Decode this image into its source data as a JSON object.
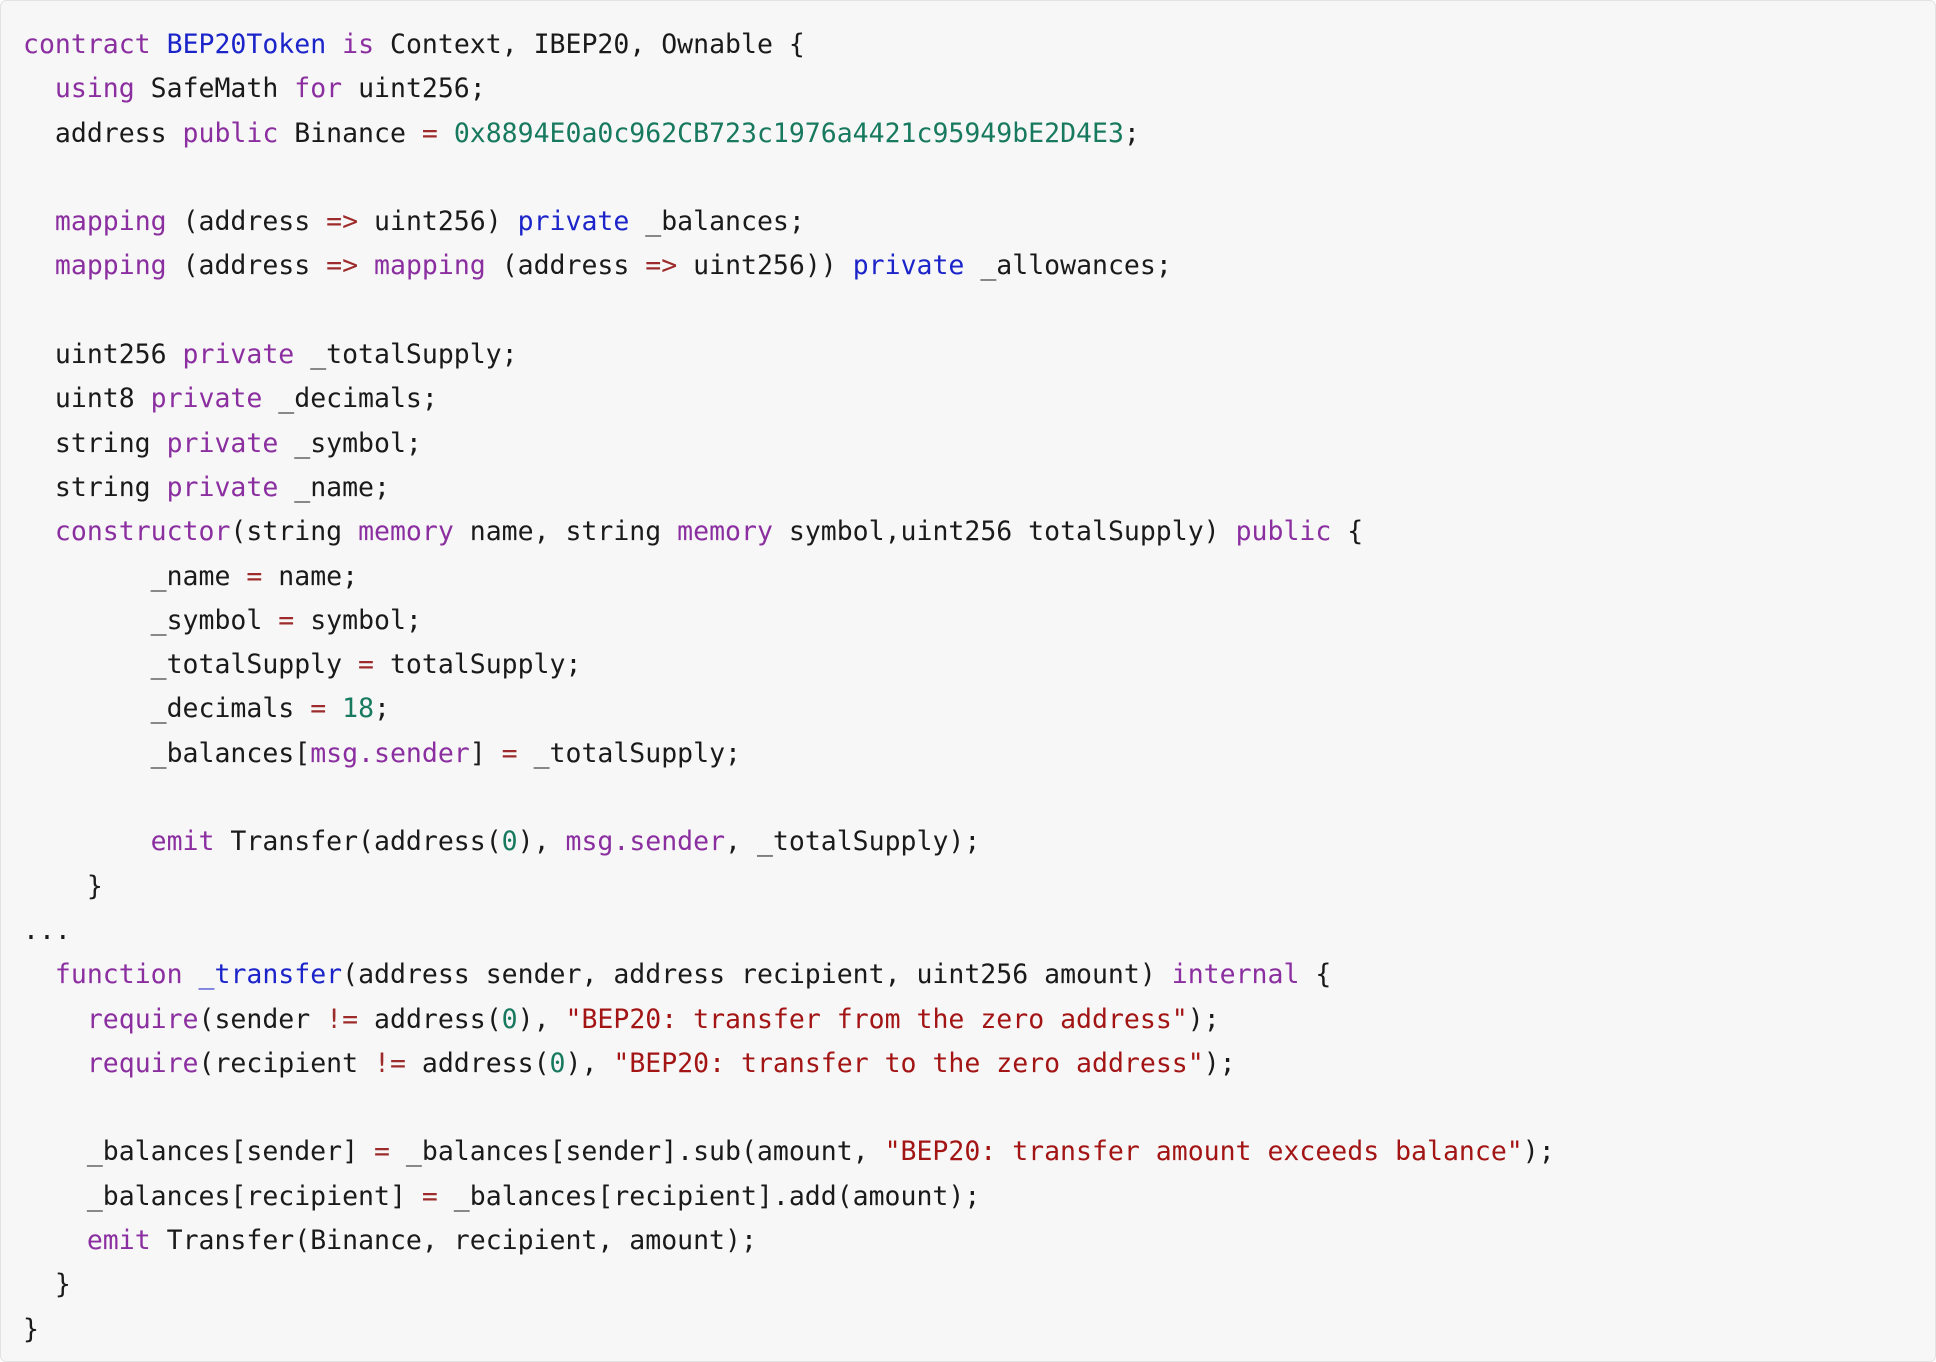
{
  "code_block": {
    "language": "solidity",
    "background_color": "#f7f7f7",
    "border_color": "#e3e3e3",
    "theme_colors": {
      "keyword": "#8b2fa0",
      "type_name": "#1b24c9",
      "number": "#17795e",
      "string": "#a31515",
      "operator": "#9e2b2b",
      "plain": "#1a1a1a"
    },
    "lines": [
      {
        "index": 1,
        "text": "contract BEP20Token is Context, IBEP20, Ownable {",
        "tokens": [
          {
            "t": "contract",
            "c": "kw"
          },
          {
            "t": " ",
            "c": "pln"
          },
          {
            "t": "BEP20Token",
            "c": "typ"
          },
          {
            "t": " ",
            "c": "pln"
          },
          {
            "t": "is",
            "c": "kw"
          },
          {
            "t": " Context, IBEP20, Ownable {",
            "c": "pln"
          }
        ]
      },
      {
        "index": 2,
        "text": "  using SafeMath for uint256;",
        "tokens": [
          {
            "t": "  ",
            "c": "pln"
          },
          {
            "t": "using",
            "c": "kw"
          },
          {
            "t": " SafeMath ",
            "c": "pln"
          },
          {
            "t": "for",
            "c": "kw"
          },
          {
            "t": " uint256;",
            "c": "pln"
          }
        ]
      },
      {
        "index": 3,
        "text": "  address public Binance = 0x8894E0a0c962CB723c1976a4421c95949bE2D4E3;",
        "tokens": [
          {
            "t": "  address ",
            "c": "pln"
          },
          {
            "t": "public",
            "c": "kw"
          },
          {
            "t": " Binance ",
            "c": "pln"
          },
          {
            "t": "=",
            "c": "op"
          },
          {
            "t": " ",
            "c": "pln"
          },
          {
            "t": "0x8894E0a0c962CB723c1976a4421c95949bE2D4E3",
            "c": "num"
          },
          {
            "t": ";",
            "c": "pln"
          }
        ]
      },
      {
        "index": 4,
        "text": "",
        "tokens": []
      },
      {
        "index": 5,
        "text": "  mapping (address => uint256) private _balances;",
        "tokens": [
          {
            "t": "  ",
            "c": "pln"
          },
          {
            "t": "mapping",
            "c": "kw"
          },
          {
            "t": " (address ",
            "c": "pln"
          },
          {
            "t": "=>",
            "c": "op"
          },
          {
            "t": " uint256) ",
            "c": "pln"
          },
          {
            "t": "private",
            "c": "typ"
          },
          {
            "t": " _balances;",
            "c": "pln"
          }
        ]
      },
      {
        "index": 6,
        "text": "  mapping (address => mapping (address => uint256)) private _allowances;",
        "tokens": [
          {
            "t": "  ",
            "c": "pln"
          },
          {
            "t": "mapping",
            "c": "kw"
          },
          {
            "t": " (address ",
            "c": "pln"
          },
          {
            "t": "=>",
            "c": "op"
          },
          {
            "t": " ",
            "c": "pln"
          },
          {
            "t": "mapping",
            "c": "kw"
          },
          {
            "t": " (address ",
            "c": "pln"
          },
          {
            "t": "=>",
            "c": "op"
          },
          {
            "t": " uint256)) ",
            "c": "pln"
          },
          {
            "t": "private",
            "c": "typ"
          },
          {
            "t": " _allowances;",
            "c": "pln"
          }
        ]
      },
      {
        "index": 7,
        "text": "",
        "tokens": []
      },
      {
        "index": 8,
        "text": "  uint256 private _totalSupply;",
        "tokens": [
          {
            "t": "  uint256 ",
            "c": "pln"
          },
          {
            "t": "private",
            "c": "kw"
          },
          {
            "t": " _totalSupply;",
            "c": "pln"
          }
        ]
      },
      {
        "index": 9,
        "text": "  uint8 private _decimals;",
        "tokens": [
          {
            "t": "  uint8 ",
            "c": "pln"
          },
          {
            "t": "private",
            "c": "kw"
          },
          {
            "t": " _decimals;",
            "c": "pln"
          }
        ]
      },
      {
        "index": 10,
        "text": "  string private _symbol;",
        "tokens": [
          {
            "t": "  string ",
            "c": "pln"
          },
          {
            "t": "private",
            "c": "kw"
          },
          {
            "t": " _symbol;",
            "c": "pln"
          }
        ]
      },
      {
        "index": 11,
        "text": "  string private _name;",
        "tokens": [
          {
            "t": "  string ",
            "c": "pln"
          },
          {
            "t": "private",
            "c": "kw"
          },
          {
            "t": " _name;",
            "c": "pln"
          }
        ]
      },
      {
        "index": 12,
        "text": "  constructor(string memory name, string memory symbol,uint256 totalSupply) public {",
        "tokens": [
          {
            "t": "  ",
            "c": "pln"
          },
          {
            "t": "constructor",
            "c": "kw"
          },
          {
            "t": "(string ",
            "c": "pln"
          },
          {
            "t": "memory",
            "c": "kw"
          },
          {
            "t": " name, string ",
            "c": "pln"
          },
          {
            "t": "memory",
            "c": "kw"
          },
          {
            "t": " symbol,uint256 totalSupply) ",
            "c": "pln"
          },
          {
            "t": "public",
            "c": "kw"
          },
          {
            "t": " {",
            "c": "pln"
          }
        ]
      },
      {
        "index": 13,
        "text": "        _name = name;",
        "tokens": [
          {
            "t": "        _name ",
            "c": "pln"
          },
          {
            "t": "=",
            "c": "op"
          },
          {
            "t": " name;",
            "c": "pln"
          }
        ]
      },
      {
        "index": 14,
        "text": "        _symbol = symbol;",
        "tokens": [
          {
            "t": "        _symbol ",
            "c": "pln"
          },
          {
            "t": "=",
            "c": "op"
          },
          {
            "t": " symbol;",
            "c": "pln"
          }
        ]
      },
      {
        "index": 15,
        "text": "        _totalSupply = totalSupply;",
        "tokens": [
          {
            "t": "        _totalSupply ",
            "c": "pln"
          },
          {
            "t": "=",
            "c": "op"
          },
          {
            "t": " totalSupply;",
            "c": "pln"
          }
        ]
      },
      {
        "index": 16,
        "text": "        _decimals = 18;",
        "tokens": [
          {
            "t": "        _decimals ",
            "c": "pln"
          },
          {
            "t": "=",
            "c": "op"
          },
          {
            "t": " ",
            "c": "pln"
          },
          {
            "t": "18",
            "c": "num"
          },
          {
            "t": ";",
            "c": "pln"
          }
        ]
      },
      {
        "index": 17,
        "text": "        _balances[msg.sender] = _totalSupply;",
        "tokens": [
          {
            "t": "        _balances[",
            "c": "pln"
          },
          {
            "t": "msg.sender",
            "c": "bi"
          },
          {
            "t": "] ",
            "c": "pln"
          },
          {
            "t": "=",
            "c": "op"
          },
          {
            "t": " _totalSupply;",
            "c": "pln"
          }
        ]
      },
      {
        "index": 18,
        "text": "",
        "tokens": []
      },
      {
        "index": 19,
        "text": "        emit Transfer(address(0), msg.sender, _totalSupply);",
        "tokens": [
          {
            "t": "        ",
            "c": "pln"
          },
          {
            "t": "emit",
            "c": "kw"
          },
          {
            "t": " Transfer(address(",
            "c": "pln"
          },
          {
            "t": "0",
            "c": "num"
          },
          {
            "t": "), ",
            "c": "pln"
          },
          {
            "t": "msg.sender",
            "c": "bi"
          },
          {
            "t": ", _totalSupply);",
            "c": "pln"
          }
        ]
      },
      {
        "index": 20,
        "text": "    }",
        "tokens": [
          {
            "t": "    }",
            "c": "pln"
          }
        ]
      },
      {
        "index": 21,
        "text": "...",
        "tokens": [
          {
            "t": "...",
            "c": "dots"
          }
        ]
      },
      {
        "index": 22,
        "text": "  function _transfer(address sender, address recipient, uint256 amount) internal {",
        "tokens": [
          {
            "t": "  ",
            "c": "pln"
          },
          {
            "t": "function",
            "c": "kw"
          },
          {
            "t": " ",
            "c": "pln"
          },
          {
            "t": "_transfer",
            "c": "typ"
          },
          {
            "t": "(address sender, address recipient, uint256 amount) ",
            "c": "pln"
          },
          {
            "t": "internal",
            "c": "kw"
          },
          {
            "t": " {",
            "c": "pln"
          }
        ]
      },
      {
        "index": 23,
        "text": "    require(sender != address(0), \"BEP20: transfer from the zero address\");",
        "tokens": [
          {
            "t": "    ",
            "c": "pln"
          },
          {
            "t": "require",
            "c": "kw"
          },
          {
            "t": "(sender ",
            "c": "pln"
          },
          {
            "t": "!=",
            "c": "op"
          },
          {
            "t": " address(",
            "c": "pln"
          },
          {
            "t": "0",
            "c": "num"
          },
          {
            "t": "), ",
            "c": "pln"
          },
          {
            "t": "\"BEP20: transfer from the zero address\"",
            "c": "str"
          },
          {
            "t": ");",
            "c": "pln"
          }
        ]
      },
      {
        "index": 24,
        "text": "    require(recipient != address(0), \"BEP20: transfer to the zero address\");",
        "tokens": [
          {
            "t": "    ",
            "c": "pln"
          },
          {
            "t": "require",
            "c": "kw"
          },
          {
            "t": "(recipient ",
            "c": "pln"
          },
          {
            "t": "!=",
            "c": "op"
          },
          {
            "t": " address(",
            "c": "pln"
          },
          {
            "t": "0",
            "c": "num"
          },
          {
            "t": "), ",
            "c": "pln"
          },
          {
            "t": "\"BEP20: transfer to the zero address\"",
            "c": "str"
          },
          {
            "t": ");",
            "c": "pln"
          }
        ]
      },
      {
        "index": 25,
        "text": "",
        "tokens": []
      },
      {
        "index": 26,
        "text": "    _balances[sender] = _balances[sender].sub(amount, \"BEP20: transfer amount exceeds balance\");",
        "tokens": [
          {
            "t": "    _balances[sender] ",
            "c": "pln"
          },
          {
            "t": "=",
            "c": "op"
          },
          {
            "t": " _balances[sender].sub(amount, ",
            "c": "pln"
          },
          {
            "t": "\"BEP20: transfer amount exceeds balance\"",
            "c": "str"
          },
          {
            "t": ");",
            "c": "pln"
          }
        ]
      },
      {
        "index": 27,
        "text": "    _balances[recipient] = _balances[recipient].add(amount);",
        "tokens": [
          {
            "t": "    _balances[recipient] ",
            "c": "pln"
          },
          {
            "t": "=",
            "c": "op"
          },
          {
            "t": " _balances[recipient].add(amount);",
            "c": "pln"
          }
        ]
      },
      {
        "index": 28,
        "text": "    emit Transfer(Binance, recipient, amount);",
        "tokens": [
          {
            "t": "    ",
            "c": "pln"
          },
          {
            "t": "emit",
            "c": "kw"
          },
          {
            "t": " Transfer(Binance, recipient, amount);",
            "c": "pln"
          }
        ]
      },
      {
        "index": 29,
        "text": "  }",
        "tokens": [
          {
            "t": "  }",
            "c": "pln"
          }
        ]
      },
      {
        "index": 30,
        "text": "}",
        "tokens": [
          {
            "t": "}",
            "c": "pln"
          }
        ]
      }
    ]
  }
}
